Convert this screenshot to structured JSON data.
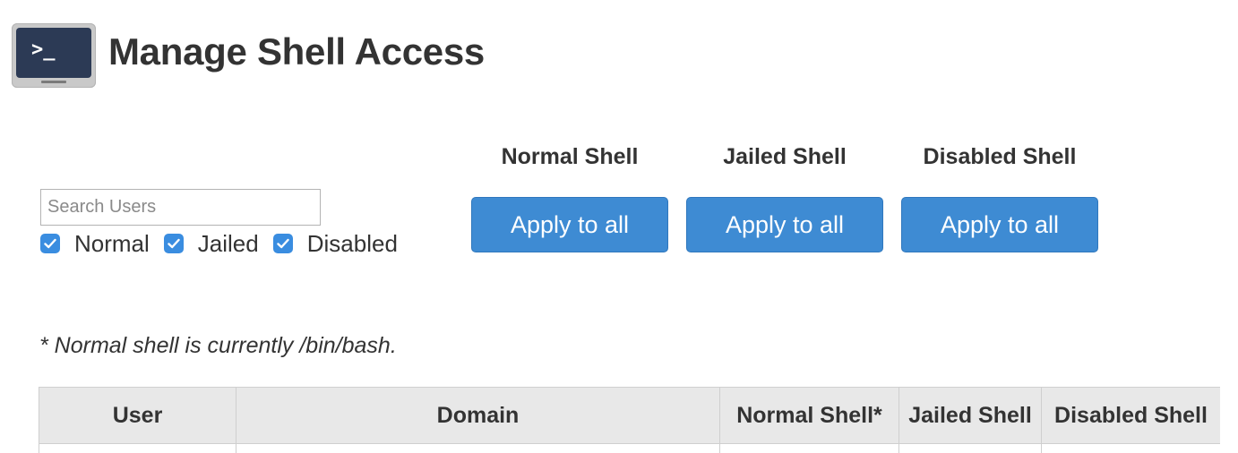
{
  "header": {
    "title": "Manage Shell Access",
    "icon": "terminal-icon",
    "icon_prompt": ">_"
  },
  "search": {
    "placeholder": "Search Users",
    "value": ""
  },
  "filters": [
    {
      "label": "Normal",
      "checked": true
    },
    {
      "label": "Jailed",
      "checked": true
    },
    {
      "label": "Disabled",
      "checked": true
    }
  ],
  "bulk_actions": [
    {
      "heading": "Normal Shell",
      "button_label": "Apply to all"
    },
    {
      "heading": "Jailed Shell",
      "button_label": "Apply to all"
    },
    {
      "heading": "Disabled Shell",
      "button_label": "Apply to all"
    }
  ],
  "note": "* Normal shell is currently /bin/bash.",
  "table": {
    "columns": [
      "User",
      "Domain",
      "Normal Shell*",
      "Jailed Shell",
      "Disabled Shell"
    ]
  },
  "colors": {
    "accent": "#3e8bd3",
    "checkbox": "#3a8de0",
    "header_bg": "#e8e8e8",
    "icon_screen": "#2c3a55"
  }
}
